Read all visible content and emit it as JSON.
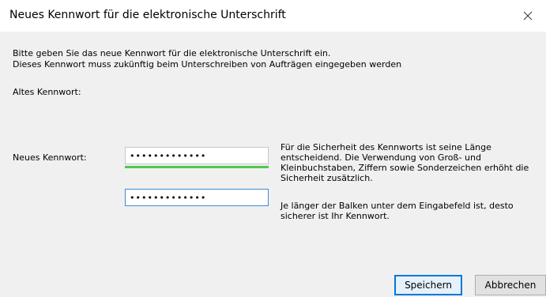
{
  "window": {
    "title": "Neues Kennwort für die elektronische Unterschrift"
  },
  "intro": {
    "line1": "Bitte geben Sie das neue Kennwort für die elektronische Unterschrift ein.",
    "line2": "Dieses Kennwort muss zukünftig beim Unterschreiben von Aufträgen eingegeben werden"
  },
  "form": {
    "old_password_label": "Altes Kennwort:",
    "new_password_label": "Neues Kennwort:",
    "new_password_value": "•••••••••••••",
    "confirm_password_value": "•••••••••••••",
    "strength_fraction": 1.0,
    "strength_color": "#4ec94a"
  },
  "hints": {
    "security": "Für die Sicherheit des Kennworts ist seine Länge entscheidend. Die Verwendung von Groß- und Kleinbuchstaben, Ziffern sowie Sonderzeichen erhöht die Sicherheit zusätzlich.",
    "bar": "Je länger der Balken unter dem Eingabefeld ist, desto sicherer ist Ihr Kennwort."
  },
  "buttons": {
    "save": "Speichern",
    "cancel": "Abbrechen"
  },
  "icons": {
    "close": "close-icon"
  }
}
